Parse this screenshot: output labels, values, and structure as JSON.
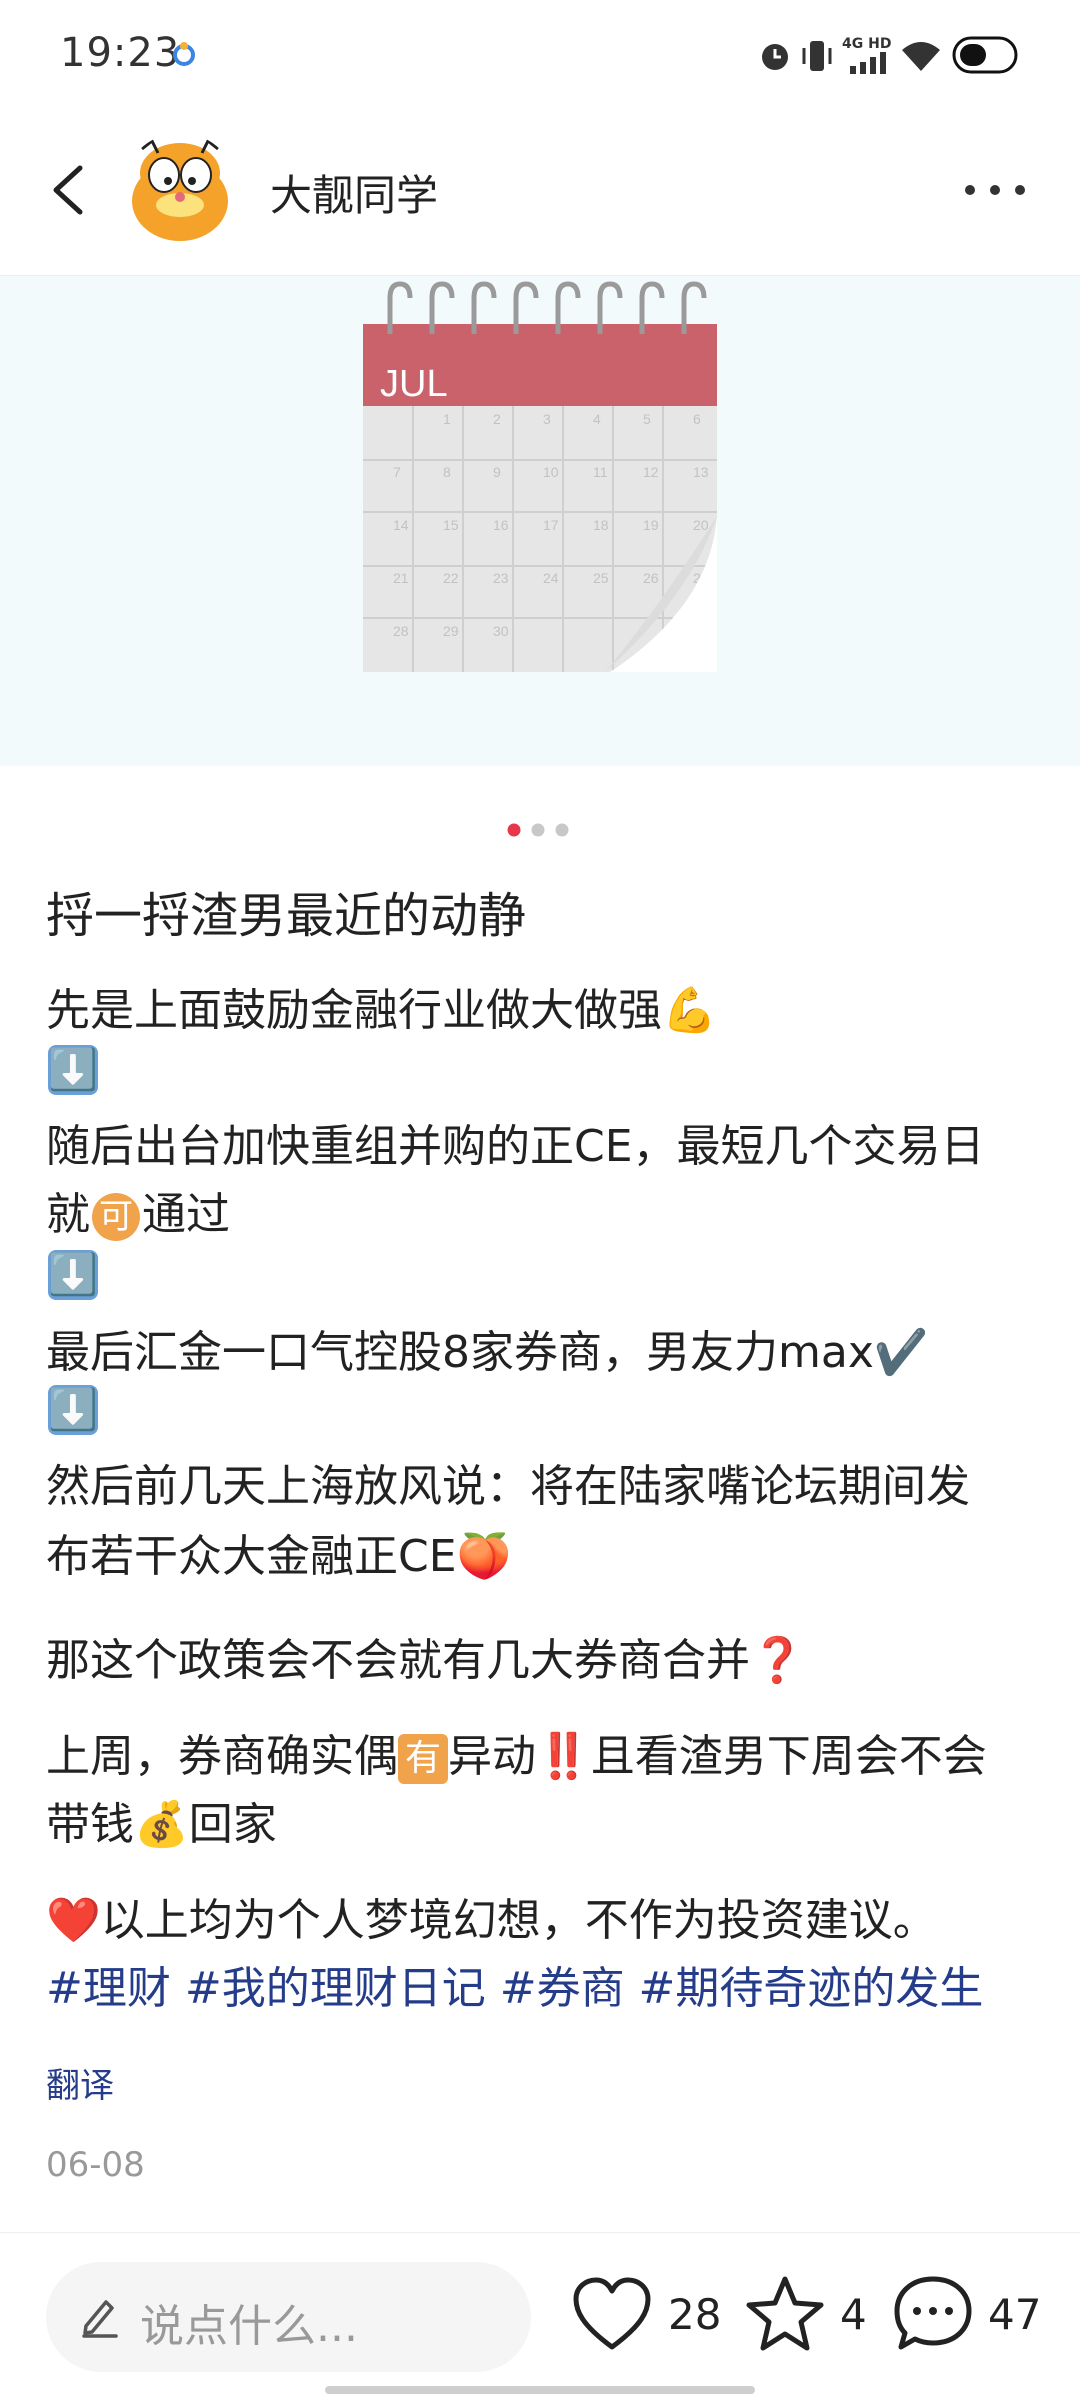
{
  "status_bar": {
    "time": "19:23",
    "network_label": "4G HD",
    "icons": [
      "alarm-icon",
      "vibrate-icon",
      "signal-icon",
      "wifi-icon",
      "battery-icon"
    ]
  },
  "header": {
    "author_name": "大靓同学",
    "icons": [
      "back-icon",
      "avatar",
      "more-icon"
    ]
  },
  "carousel": {
    "calendar_month": "JUL",
    "calendar_days": [
      "1",
      "2",
      "3",
      "4",
      "5",
      "6",
      "7",
      "8",
      "9",
      "10",
      "11",
      "12",
      "13",
      "14",
      "15",
      "16",
      "17",
      "18",
      "19",
      "20",
      "21",
      "22",
      "23",
      "24",
      "25",
      "26",
      "27",
      "28",
      "29",
      "30"
    ],
    "current_page": 1,
    "page_count": 3,
    "accent_color": "#e8374a"
  },
  "post": {
    "title": "捋一捋渣男最近的动静",
    "lines": {
      "l1": "先是上面鼓励金融行业做大做强💪",
      "l2a": "随后出台加快重组并购的正CE，最短几个交易日",
      "l2b": "就",
      "l2b_badge": "可",
      "l2b_rest": "通过",
      "l3": "最后汇金一口气控股8家券商，男友力max✔️",
      "l4a": "然后前几天上海放风说：将在陆家嘴论坛期间发",
      "l4b": "布若干众大金融正CE🍑",
      "l5": "那这个政策会不会就有几大券商合并",
      "l5_mark": "❓",
      "l6a_pre": "上周，券商确实偶",
      "l6a_badge": "有",
      "l6a_post": "异动",
      "l6a_mark": "‼️",
      "l6a_tail": "且看渣男下周会不会",
      "l6b_pre": "带钱",
      "l6b_emoji": "💰",
      "l6b_post": "回家",
      "l7_heart": "❤️",
      "l7": "以上均为个人梦境幻想，不作为投资建议。"
    },
    "arrow_emoji": "⬇️",
    "hashtags": "#理财 #我的理财日记 #券商 #期待奇迹的发生",
    "translate_label": "翻译",
    "date": "06-08",
    "hashtag_color": "#243c8a"
  },
  "bottom_bar": {
    "comment_placeholder": "说点什么...",
    "likes": "28",
    "favorites": "4",
    "comments": "47",
    "icons": [
      "pen-icon",
      "heart-icon",
      "star-icon",
      "comment-icon"
    ]
  }
}
